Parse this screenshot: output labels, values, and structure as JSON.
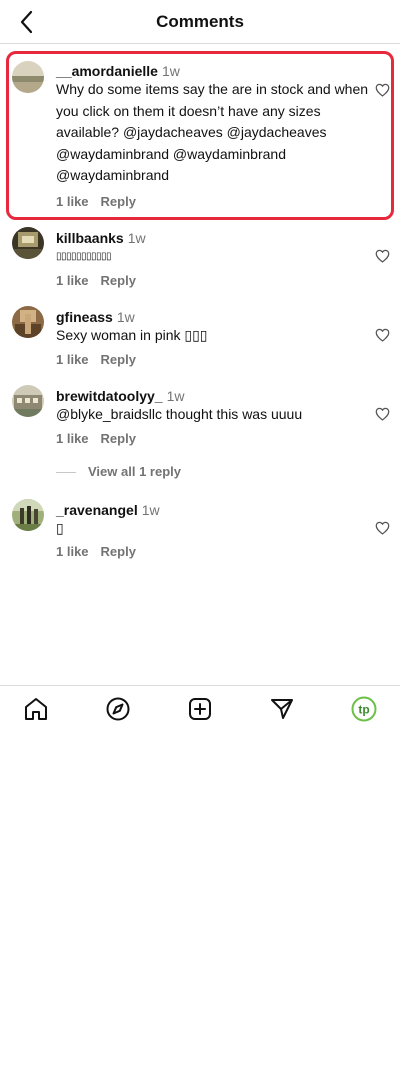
{
  "header": {
    "title": "Comments",
    "back_icon": "chevron-left-icon"
  },
  "comments": [
    {
      "user": "__amordanielle",
      "time": "1w",
      "text": "Why do some items say the are in stock and when you click on them it doesn’t have any sizes available? @jaydacheaves @jaydacheaves @waydaminbrand @waydaminbrand @waydaminbrand",
      "likes": "1 like",
      "reply": "Reply",
      "highlighted": true
    },
    {
      "user": "killbaanks",
      "time": "1w",
      "text": "▯▯▯▯▯▯▯▯▯▯▯",
      "likes": "1 like",
      "reply": "Reply"
    },
    {
      "user": "gfineass",
      "time": "1w",
      "text": "Sexy woman in pink ▯▯▯",
      "likes": "1 like",
      "reply": "Reply"
    },
    {
      "user": "brewitdatoolyy_",
      "time": "1w",
      "text": "@blyke_braidsllc thought this was uuuu",
      "likes": "1 like",
      "reply": "Reply",
      "view_replies": "View all 1 reply"
    },
    {
      "user": "_ravenangel",
      "time": "1w",
      "text": "▯",
      "likes": "1 like",
      "reply": "Reply"
    }
  ],
  "nav": {
    "items": [
      {
        "icon": "home-icon"
      },
      {
        "icon": "explore-compass-icon"
      },
      {
        "icon": "create-plus-icon"
      },
      {
        "icon": "send-message-icon"
      },
      {
        "icon": "profile-avatar-icon",
        "text": "tp"
      }
    ]
  },
  "colors": {
    "highlight": "#e8283c",
    "muted": "#737373",
    "divider": "#dbdbdb",
    "profile_accent": "#6cc04a"
  }
}
